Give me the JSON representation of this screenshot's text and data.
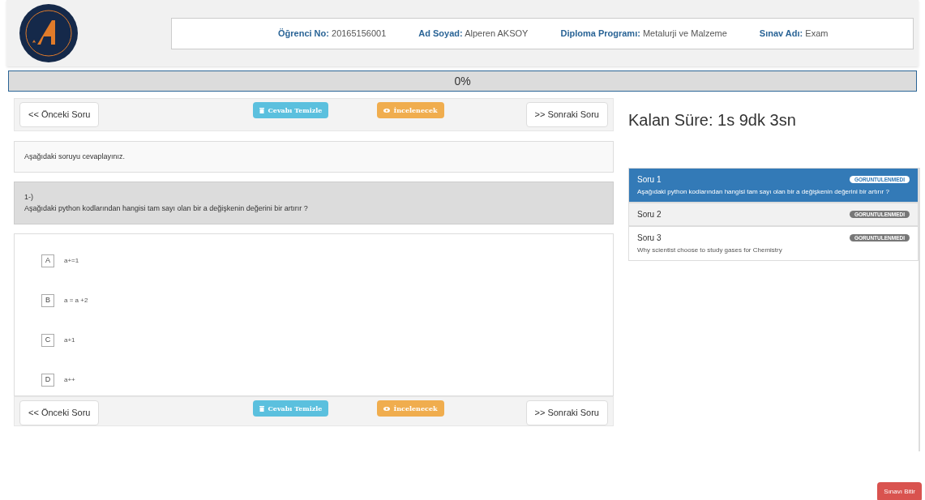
{
  "header": {
    "fields": [
      {
        "label": "Öğrenci No:",
        "value": "20165156001"
      },
      {
        "label": "Ad Soyad:",
        "value": "Alperen AKSOY"
      },
      {
        "label": "Diploma Programı:",
        "value": "Metalurji ve Malzeme"
      },
      {
        "label": "Sınav Adı:",
        "value": "Exam"
      }
    ]
  },
  "progress": {
    "level": 0,
    "reading": "0%"
  },
  "toolbars": [
    {
      "prev": "<< Önceki Soru",
      "clear": "Cevabı Temizle",
      "review": "İncelenecek",
      "next": ">> Sonraki Soru"
    },
    {
      "prev": "<< Önceki Soru",
      "clear": "Cevabı Temizle",
      "review": "İncelenecek",
      "next": ">> Sonraki Soru"
    }
  ],
  "instruction": "Aşağıdaki soruyu cevaplayınız.",
  "question": {
    "number": "1-)",
    "text": "Aşağıdaki python kodlarından hangisi tam sayı olan bir a değişkenin değerini bir artırır ?"
  },
  "options": [
    {
      "letter": "A",
      "text": "a+=1"
    },
    {
      "letter": "B",
      "text": "a = a +2"
    },
    {
      "letter": "C",
      "text": "a+1"
    },
    {
      "letter": "D",
      "text": "a++"
    }
  ],
  "timer": "Kalan Süre: 1s 9dk 3sn",
  "question_list": [
    {
      "title": "Soru 1",
      "badge": "GORUNTULENMEDI",
      "subtitle": "Aşağıdaki python kodlarından hangisi tam sayı olan bir a değişkenin değerini bir artırır ?",
      "selected": true
    },
    {
      "title": "Soru 2",
      "badge": "GORUNTULENMEDI",
      "selected": false
    },
    {
      "title": "Soru 3",
      "badge": "GORUNTULENMEDI",
      "subtitle": "Why scientist choose to study gases for Chemistry",
      "selected": false
    }
  ],
  "finish_button": "Sınavı Bitir"
}
